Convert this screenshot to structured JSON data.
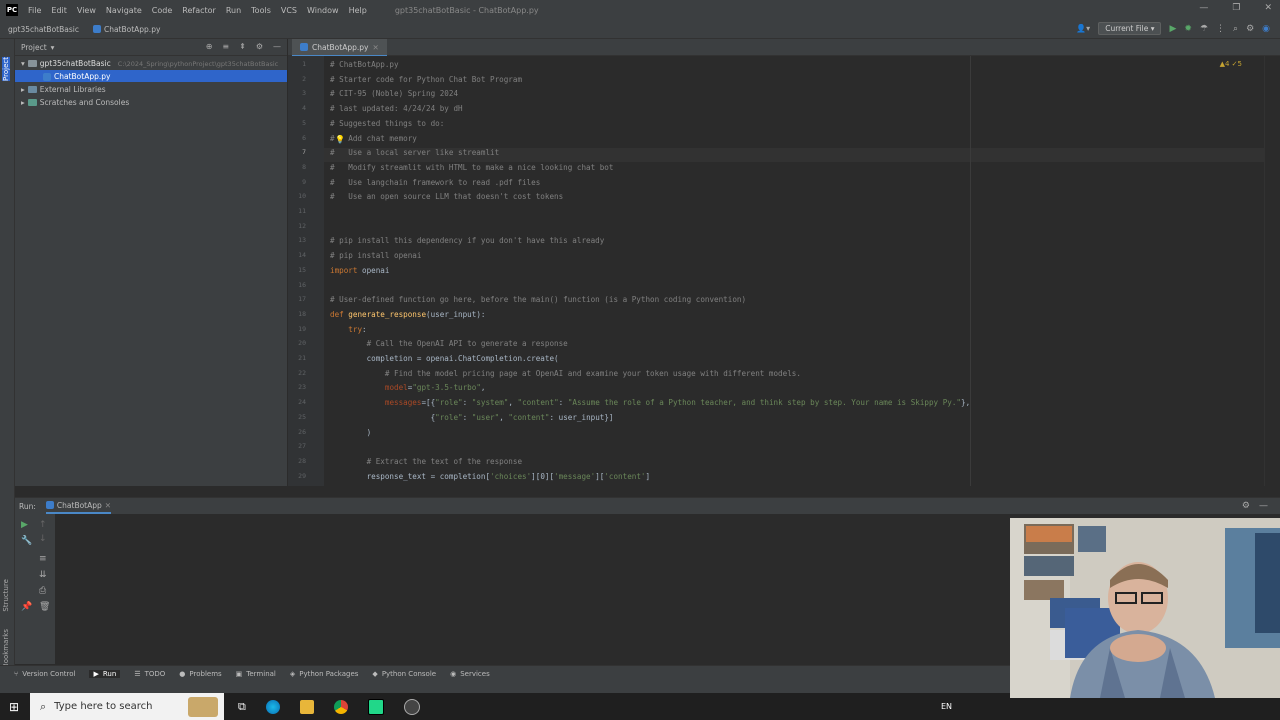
{
  "menu": {
    "items": [
      "File",
      "Edit",
      "View",
      "Navigate",
      "Code",
      "Refactor",
      "Run",
      "Tools",
      "VCS",
      "Window",
      "Help"
    ],
    "window_title": "gpt35chatBotBasic - ChatBotApp.py"
  },
  "navbar": {
    "project": "gpt35chatBotBasic",
    "file": "ChatBotApp.py",
    "run_config": "Current File"
  },
  "project_panel": {
    "title": "Project",
    "root": "gpt35chatBotBasic",
    "root_path": "C:\\2024_Spring\\pythonProject\\gpt35chatBotBasic",
    "file": "ChatBotApp.py",
    "external": "External Libraries",
    "scratches": "Scratches and Consoles"
  },
  "editor": {
    "tab": "ChatBotApp.py",
    "inspection": "▲4 ✓5",
    "lines": [
      {
        "n": "1",
        "parts": [
          [
            "com",
            "# ChatBotApp.py"
          ]
        ]
      },
      {
        "n": "2",
        "parts": [
          [
            "com",
            "# Starter code for Python Chat Bot Program"
          ]
        ]
      },
      {
        "n": "3",
        "parts": [
          [
            "com",
            "# CIT-95 (Noble) Spring 2024"
          ]
        ]
      },
      {
        "n": "4",
        "parts": [
          [
            "com",
            "# last updated: 4/24/24 by dH"
          ]
        ]
      },
      {
        "n": "5",
        "parts": [
          [
            "com",
            "# Suggested things to do:"
          ]
        ]
      },
      {
        "n": "6",
        "parts": [
          [
            "com",
            "#   Add chat memory"
          ]
        ]
      },
      {
        "n": "7",
        "parts": [
          [
            "com",
            "#   Use a local server like streamlit"
          ]
        ]
      },
      {
        "n": "8",
        "parts": [
          [
            "com",
            "#   Modify streamlit with HTML to make a nice looking chat bot"
          ]
        ]
      },
      {
        "n": "9",
        "parts": [
          [
            "com",
            "#   Use langchain framework to read .pdf files"
          ]
        ]
      },
      {
        "n": "10",
        "parts": [
          [
            "com",
            "#   Use an open source LLM that doesn't cost tokens"
          ]
        ]
      },
      {
        "n": "11",
        "parts": []
      },
      {
        "n": "12",
        "parts": []
      },
      {
        "n": "13",
        "parts": [
          [
            "com",
            "# pip install this dependency if you don't have this already"
          ]
        ]
      },
      {
        "n": "14",
        "parts": [
          [
            "com",
            "# pip install openai"
          ]
        ]
      },
      {
        "n": "15",
        "parts": [
          [
            "kw",
            "import "
          ],
          [
            "var",
            "openai"
          ]
        ]
      },
      {
        "n": "16",
        "parts": []
      },
      {
        "n": "17",
        "parts": [
          [
            "com",
            "# User-defined function go here, before the main() function (is a Python coding convention)"
          ]
        ]
      },
      {
        "n": "18",
        "parts": [
          [
            "kw",
            "def "
          ],
          [
            "fn",
            "generate_response"
          ],
          [
            "var",
            "(user_input):"
          ]
        ]
      },
      {
        "n": "19",
        "parts": [
          [
            "var",
            "    "
          ],
          [
            "kw",
            "try"
          ],
          [
            "var",
            ":"
          ]
        ]
      },
      {
        "n": "20",
        "parts": [
          [
            "var",
            "        "
          ],
          [
            "com",
            "# Call the OpenAI API to generate a response"
          ]
        ]
      },
      {
        "n": "21",
        "parts": [
          [
            "var",
            "        completion = openai.ChatCompletion.create("
          ]
        ]
      },
      {
        "n": "22",
        "parts": [
          [
            "var",
            "            "
          ],
          [
            "com",
            "# Find the model pricing page at OpenAI and examine your token usage with different models."
          ]
        ]
      },
      {
        "n": "23",
        "parts": [
          [
            "var",
            "            "
          ],
          [
            "param",
            "model"
          ],
          [
            "var",
            "="
          ],
          [
            "str",
            "\"gpt-3.5-turbo\""
          ],
          [
            "var",
            ","
          ]
        ]
      },
      {
        "n": "24",
        "parts": [
          [
            "var",
            "            "
          ],
          [
            "param",
            "messages"
          ],
          [
            "var",
            "=[{"
          ],
          [
            "str",
            "\"role\""
          ],
          [
            "var",
            ": "
          ],
          [
            "str",
            "\"system\""
          ],
          [
            "var",
            ", "
          ],
          [
            "str",
            "\"content\""
          ],
          [
            "var",
            ": "
          ],
          [
            "str",
            "\"Assume the role of a Python teacher, and think step by step. Your name is Skippy Py.\""
          ],
          [
            "var",
            "},"
          ]
        ]
      },
      {
        "n": "25",
        "parts": [
          [
            "var",
            "                      {"
          ],
          [
            "str",
            "\"role\""
          ],
          [
            "var",
            ": "
          ],
          [
            "str",
            "\"user\""
          ],
          [
            "var",
            ", "
          ],
          [
            "str",
            "\"content\""
          ],
          [
            "var",
            ": user_input}]"
          ]
        ]
      },
      {
        "n": "26",
        "parts": [
          [
            "var",
            "        )"
          ]
        ]
      },
      {
        "n": "27",
        "parts": []
      },
      {
        "n": "28",
        "parts": [
          [
            "var",
            "        "
          ],
          [
            "com",
            "# Extract the text of the response"
          ]
        ]
      },
      {
        "n": "29",
        "parts": [
          [
            "var",
            "        response_text = completion["
          ],
          [
            "str",
            "'choices'"
          ],
          [
            "var",
            "][0]["
          ],
          [
            "str",
            "'message'"
          ],
          [
            "var",
            "]["
          ],
          [
            "str",
            "'content'"
          ],
          [
            "var",
            "]"
          ]
        ]
      }
    ]
  },
  "run_panel": {
    "label": "Run:",
    "tab": "ChatBotApp"
  },
  "left_strip": {
    "project": "Project",
    "bookmarks": "Bookmarks",
    "structure": "Structure"
  },
  "bottom_tools": [
    "Version Control",
    "Run",
    "TODO",
    "Problems",
    "Terminal",
    "Python Packages",
    "Python Console",
    "Services"
  ],
  "taskbar": {
    "search_placeholder": "Type here to search",
    "lang": "EN"
  }
}
